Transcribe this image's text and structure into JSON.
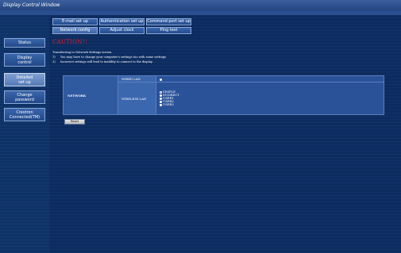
{
  "window": {
    "title": "Display Control Window"
  },
  "sidebar": {
    "items": [
      {
        "label": "Status"
      },
      {
        "label_line1": "Display",
        "label_line2": "control"
      },
      {
        "label_line1": "Detailed",
        "label_line2": "set up",
        "active": true
      },
      {
        "label_line1": "Change",
        "label_line2": "password"
      },
      {
        "label_line1": "Crestron",
        "label_line2": "Connected(TM)"
      }
    ]
  },
  "tabs": {
    "row1": [
      "E-mail set up",
      "Authentication set up",
      "Command port set up"
    ],
    "row2": [
      "Network config",
      "Adjust clock",
      "Ping test"
    ],
    "active": "Network config"
  },
  "main": {
    "caution": "CAUTION!!",
    "intro": "Transferring to Network Settings screen.",
    "notes": [
      {
        "num": "1)",
        "text": "You may have to change your computer's settings too with some settings."
      },
      {
        "num": "2)",
        "text": "Incorrect settings will lead to inability to connect to the display."
      }
    ],
    "network": {
      "label": "NETWORK",
      "wired_label": "WIRED LAN",
      "wireless_label": "WIRELESS LAN",
      "wireless_options": [
        "SIMPLE",
        "M-DIRECT",
        "USER1",
        "USER2",
        "USER3"
      ]
    },
    "reset_label": "Reset"
  },
  "colors": {
    "background": "#0d2c5e",
    "caution": "#e3202a",
    "tab": "#2f5aa0",
    "table_cell": "#2a5299"
  }
}
